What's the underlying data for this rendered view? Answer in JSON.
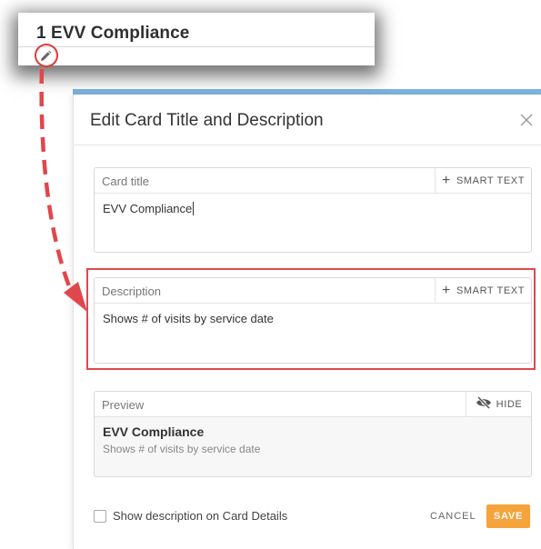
{
  "card": {
    "title": "1 EVV Compliance"
  },
  "dialog": {
    "title": "Edit Card Title and Description",
    "card_title_field": {
      "label": "Card title",
      "smart_text": "SMART TEXT",
      "value": "EVV Compliance"
    },
    "description_field": {
      "label": "Description",
      "smart_text": "SMART TEXT",
      "value": "Shows # of visits by service date"
    },
    "preview": {
      "label": "Preview",
      "hide_label": "HIDE",
      "title": "EVV Compliance",
      "description": "Shows # of visits by service date"
    },
    "show_description_label": "Show description on Card Details",
    "cancel_label": "CANCEL",
    "save_label": "SAVE"
  },
  "colors": {
    "annotation_red": "#e0474c",
    "save_orange": "#f6a33b"
  },
  "icons": [
    "pencil-icon",
    "close-icon",
    "plus-icon",
    "eye-slash-icon"
  ]
}
